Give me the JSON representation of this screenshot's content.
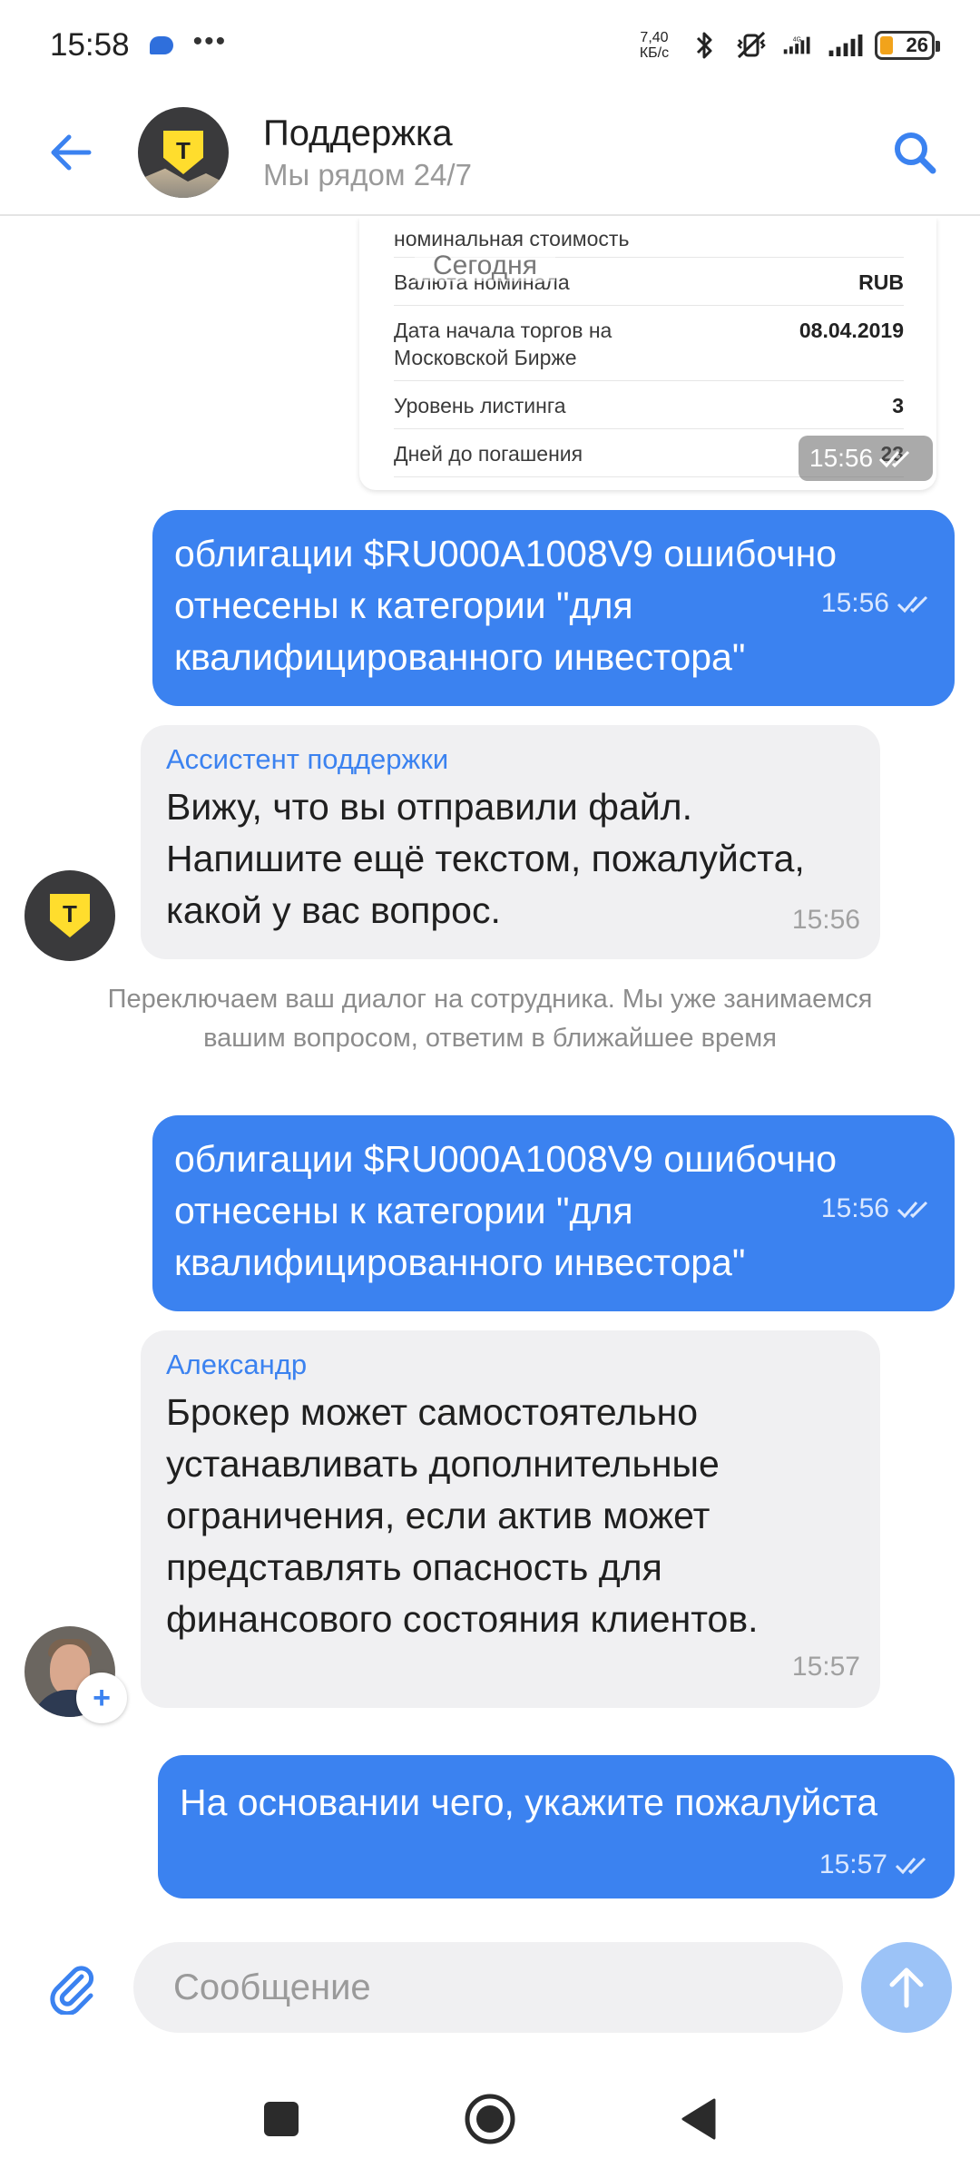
{
  "status_bar": {
    "time": "15:58",
    "dots": "•••",
    "net_speed_value": "7,40",
    "net_speed_unit": "КБ/c",
    "network_type": "4G",
    "battery": "26",
    "battery_color": "#f2a31b"
  },
  "header": {
    "title": "Поддержка",
    "subtitle": "Мы рядом 24/7",
    "avatar_icon": "t-shield-logo",
    "back_icon": "arrow-left-icon",
    "search_icon": "search-icon"
  },
  "chat": {
    "date_divider": "Сегодня",
    "bond_card": {
      "cut_text": "номинальная стоимость",
      "rows": [
        {
          "key": "Валюта номинала",
          "value": "RUB"
        },
        {
          "key": "Дата начала торгов на Московской Бирже",
          "value": "08.04.2019"
        },
        {
          "key": "Уровень листинга",
          "value": "3"
        },
        {
          "key": "Дней до погашения",
          "value": "23"
        }
      ],
      "time": "15:56"
    },
    "messages": [
      {
        "direction": "out",
        "text": "облигации $RU000A1008V9 ошибочно отнесены к категории \"для квалифицированного инвестора\"",
        "time": "15:56"
      },
      {
        "direction": "in",
        "sender": "Ассистент поддержки",
        "text": "Вижу, что вы отправили файл. Напишите ещё текстом, пожалуйста, какой у вас вопрос.",
        "time": "15:56"
      },
      {
        "direction": "out",
        "text": "облигации $RU000A1008V9 ошибочно отнесены к категории \"для квалифицированного инвестора\"",
        "time": "15:56"
      },
      {
        "direction": "in",
        "sender": "Александр",
        "text": "Брокер может самостоятельно устанавливать дополнительные ограничения, если актив может представлять опасность для финансового состояния клиентов.",
        "time": "15:57"
      },
      {
        "direction": "out",
        "text": "На основании чего, укажите пожалуйста",
        "time": "15:57"
      }
    ],
    "system_note": "Переключаем ваш диалог на сотрудника. Мы уже занимаемся вашим вопросом, ответим в ближайшее время",
    "bot_logo_letter": "T",
    "plus_badge": "+"
  },
  "composer": {
    "placeholder": "Сообщение",
    "value": "",
    "attach_icon": "paperclip-icon",
    "send_icon": "arrow-up-icon"
  },
  "nav_bar": {
    "items": [
      "recents-square-icon",
      "home-circle-icon",
      "back-triangle-icon"
    ]
  },
  "colors": {
    "accent": "#3b82f0",
    "outgoing_bubble": "#3b82f0",
    "incoming_bubble": "#f0f0f2",
    "brand_yellow": "#ffdd2d",
    "send_button_disabled": "#9cc3f7"
  }
}
